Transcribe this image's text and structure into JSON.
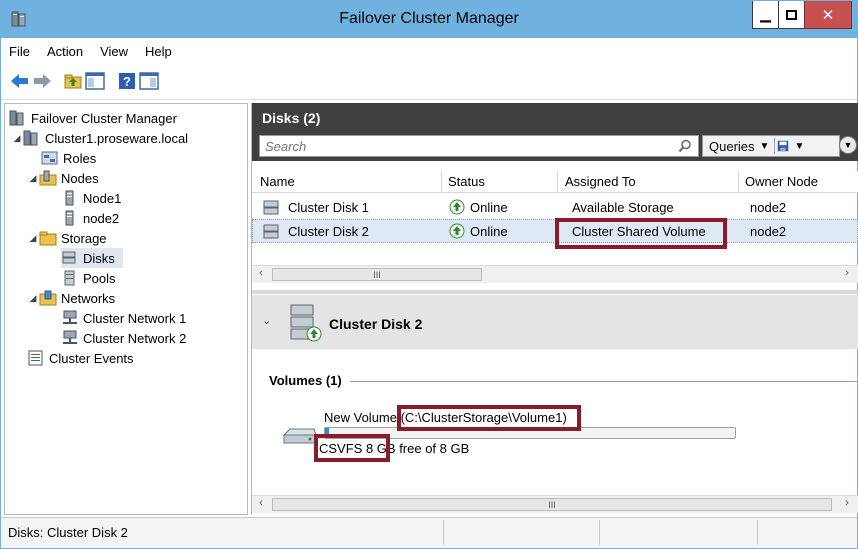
{
  "window": {
    "title": "Failover Cluster Manager"
  },
  "menu": [
    "File",
    "Action",
    "View",
    "Help"
  ],
  "tree": {
    "root": "Failover Cluster Manager",
    "cluster": "Cluster1.proseware.local",
    "roles": "Roles",
    "nodes": "Nodes",
    "node1": "Node1",
    "node2": "node2",
    "storage": "Storage",
    "disks": "Disks",
    "pools": "Pools",
    "networks": "Networks",
    "net1": "Cluster Network 1",
    "net2": "Cluster Network 2",
    "events": "Cluster Events"
  },
  "pane": {
    "title": "Disks (2)",
    "search_placeholder": "Search",
    "queries_label": "Queries"
  },
  "grid": {
    "columns": [
      "Name",
      "Status",
      "Assigned To",
      "Owner Node"
    ],
    "rows": [
      {
        "name": "Cluster Disk 1",
        "status": "Online",
        "assigned": "Available Storage",
        "owner": "node2"
      },
      {
        "name": "Cluster Disk 2",
        "status": "Online",
        "assigned": "Cluster Shared Volume",
        "owner": "node2"
      }
    ]
  },
  "detail": {
    "title": "Cluster Disk 2",
    "volumes_label": "Volumes (1)",
    "volume_name": "New Volume (C:\\ClusterStorage\\Volume1)",
    "volume_free": "CSVFS 8 GB free of 8 GB",
    "volume_used_fraction": 0.01
  },
  "status": {
    "text": "Disks:  Cluster Disk 2"
  },
  "colors": {
    "titlebar": "#6fb2e0",
    "pane_header": "#404040",
    "highlight": "#8b1a2a",
    "close": "#c75050"
  }
}
